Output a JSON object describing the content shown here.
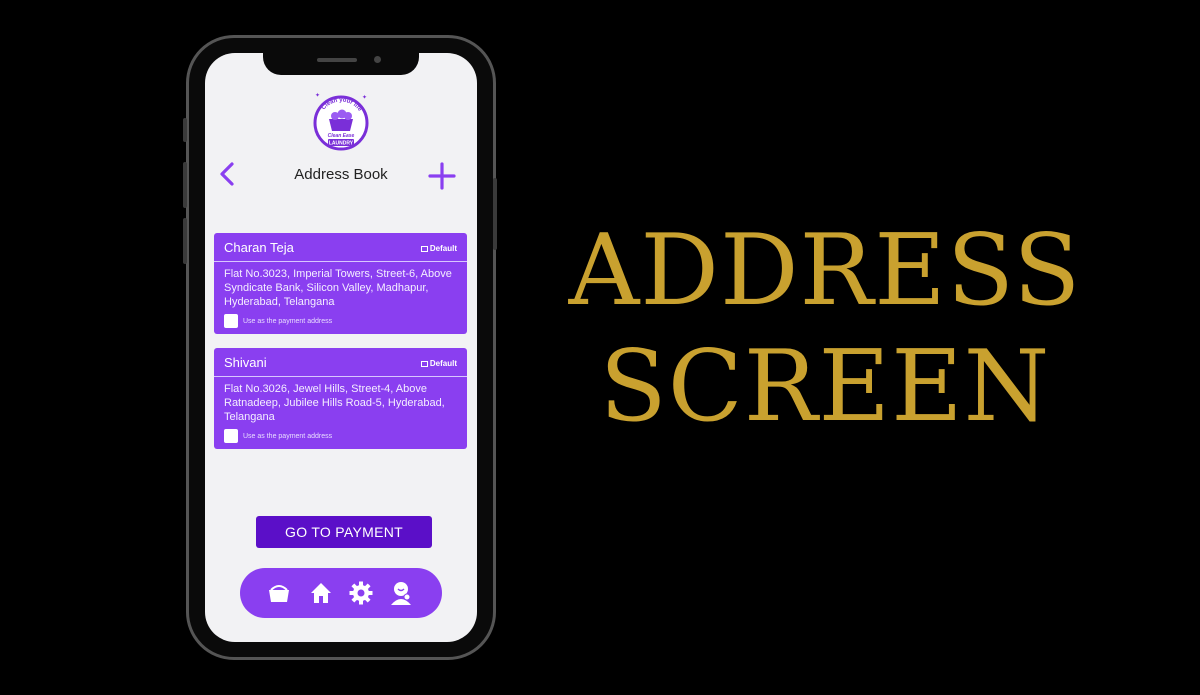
{
  "brand": {
    "logo_tagline": "Clean your life",
    "logo_name_line1": "Clean Ease",
    "logo_name_line2": "LAUNDRY"
  },
  "header": {
    "title": "Address Book",
    "back_icon": "chevron-left-icon",
    "add_icon": "plus-icon"
  },
  "addresses": [
    {
      "name": "Charan Teja",
      "badge": "Default",
      "address": "Flat No.3023, Imperial Towers, Street-6, Above Syndicate Bank, Silicon Valley, Madhapur, Hyderabad, Telangana",
      "checkbox_label": "Use as the payment address"
    },
    {
      "name": "Shivani",
      "badge": "Default",
      "address": "Flat No.3026, Jewel Hills, Street-4, Above Ratnadeep,  Jubilee Hills Road-5, Hyderabad, Telangana",
      "checkbox_label": "Use as the payment address"
    }
  ],
  "payment_button": "GO TO PAYMENT",
  "bottom_nav": [
    "basket-icon",
    "home-icon",
    "gear-icon",
    "profile-icon"
  ],
  "headline": {
    "line1": "ADDRESS",
    "line2": "SCREEN"
  },
  "colors": {
    "accent": "#8a3ff0",
    "button": "#5b0fc8",
    "headline": "#c9a12f",
    "background": "#000000"
  }
}
